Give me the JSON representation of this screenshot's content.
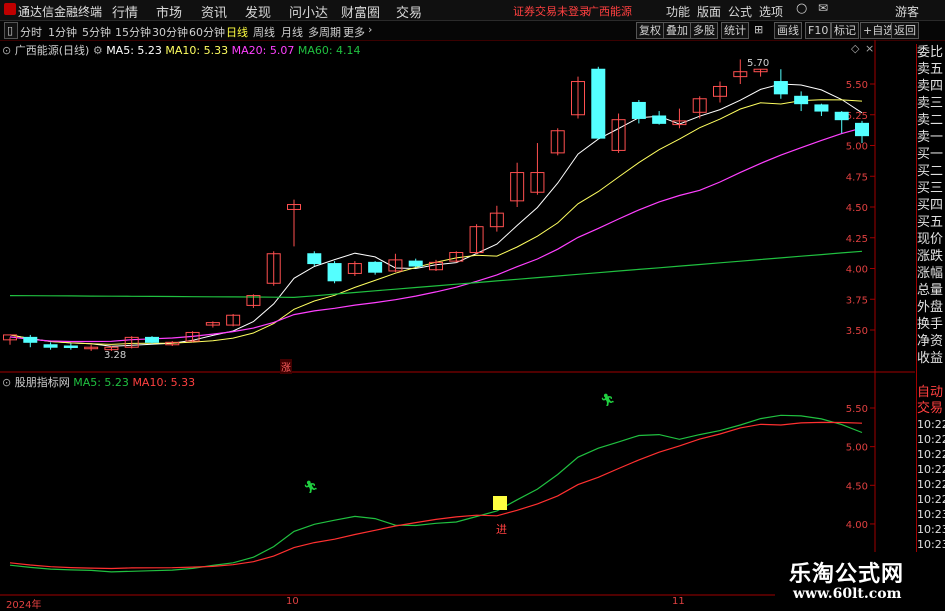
{
  "titlebar": {
    "app_name": "通达信金融终端",
    "menus": [
      "行情",
      "市场",
      "资讯",
      "发现",
      "问小达",
      "财富圈",
      "交易"
    ],
    "status": "证券交易未登录",
    "stock_name": "广西能源",
    "right_menus": [
      "功能",
      "版面",
      "公式",
      "选项"
    ],
    "guest": "游客",
    "colors": {
      "status": "#ff4040"
    }
  },
  "toolbar": {
    "periods": [
      "分时",
      "1分钟",
      "5分钟",
      "15分钟",
      "30分钟",
      "60分钟",
      "日线",
      "周线",
      "月线",
      "多周期",
      "更多"
    ],
    "active_period": "日线",
    "buttons": [
      "复权",
      "叠加",
      "多股",
      "统计",
      "画线",
      "F10",
      "标记",
      "+自选",
      "返回"
    ]
  },
  "main_chart": {
    "title": "广西能源(日线)",
    "ma5_label": "MA5: 5.23",
    "ma10_label": "MA10: 5.33",
    "ma20_label": "MA20: 5.07",
    "ma60_label": "MA60: 4.14",
    "high_label": "5.70",
    "low_label": "3.28",
    "signal_label": "涨",
    "price_ticks": [
      "5.50",
      "5.25",
      "5.00",
      "4.75",
      "4.50",
      "4.25",
      "4.00",
      "3.75",
      "3.50"
    ],
    "colors": {
      "ma5": "#ffffff",
      "ma10": "#ffff60",
      "ma20": "#ff40ff",
      "ma60": "#20c040",
      "up": "#ff5050",
      "down": "#54ffff"
    }
  },
  "indicator": {
    "title": "股朋指标网",
    "ma5_label": "MA5: 5.23",
    "ma10_label": "MA10: 5.33",
    "buy_label": "进",
    "ticks": [
      "5.50",
      "5.00",
      "4.50",
      "4.00"
    ]
  },
  "time_axis": {
    "labels": [
      "2024年",
      "10",
      "11"
    ]
  },
  "right_panel": {
    "items": [
      "委比",
      "卖五",
      "卖四",
      "卖三",
      "卖二",
      "卖一",
      "买一",
      "买二",
      "买三",
      "买四",
      "买五",
      "现价",
      "涨跌",
      "涨幅",
      "总量",
      "外盘",
      "换手",
      "净资",
      "收益"
    ],
    "lower_items": [
      "自动",
      "交易",
      "10:22",
      "10:22",
      "10:22",
      "10:22",
      "10:22",
      "10:22",
      "10:23",
      "10:23",
      "10:23",
      "10:23",
      "10:23"
    ]
  },
  "watermark": {
    "title": "乐淘公式网",
    "url": "www.60lt.com"
  },
  "chart_data": {
    "type": "candlestick",
    "candles": [
      [
        3.42,
        3.46,
        3.38,
        3.44
      ],
      [
        3.44,
        3.4,
        3.36,
        3.46
      ],
      [
        3.38,
        3.36,
        3.34,
        3.4
      ],
      [
        3.37,
        3.36,
        3.34,
        3.39
      ],
      [
        3.35,
        3.36,
        3.33,
        3.38
      ],
      [
        3.34,
        3.36,
        3.33,
        3.37
      ],
      [
        3.36,
        3.44,
        3.35,
        3.45
      ],
      [
        3.44,
        3.4,
        3.39,
        3.45
      ],
      [
        3.38,
        3.4,
        3.37,
        3.41
      ],
      [
        3.41,
        3.48,
        3.4,
        3.49
      ],
      [
        3.54,
        3.56,
        3.52,
        3.57
      ],
      [
        3.54,
        3.62,
        3.53,
        3.63
      ],
      [
        3.7,
        3.78,
        3.68,
        3.79
      ],
      [
        3.88,
        4.12,
        3.86,
        4.14
      ],
      [
        4.48,
        4.52,
        4.18,
        4.56
      ],
      [
        4.12,
        4.04,
        4.02,
        4.14
      ],
      [
        4.04,
        3.9,
        3.88,
        4.06
      ],
      [
        3.96,
        4.04,
        3.94,
        4.06
      ],
      [
        4.05,
        3.97,
        3.95,
        4.06
      ],
      [
        3.98,
        4.07,
        3.97,
        4.12
      ],
      [
        4.06,
        4.02,
        4.01,
        4.08
      ],
      [
        3.99,
        4.05,
        3.98,
        4.07
      ],
      [
        4.06,
        4.13,
        4.05,
        4.14
      ],
      [
        4.13,
        4.34,
        4.12,
        4.36
      ],
      [
        4.34,
        4.45,
        4.3,
        4.51
      ],
      [
        4.55,
        4.78,
        4.5,
        4.86
      ],
      [
        4.62,
        4.78,
        4.6,
        5.02
      ],
      [
        4.94,
        5.12,
        4.92,
        5.14
      ],
      [
        5.25,
        5.52,
        5.22,
        5.56
      ],
      [
        5.62,
        5.06,
        5.05,
        5.64
      ],
      [
        4.96,
        5.21,
        4.94,
        5.26
      ],
      [
        5.35,
        5.22,
        5.18,
        5.37
      ],
      [
        5.24,
        5.18,
        5.17,
        5.28
      ],
      [
        5.17,
        5.2,
        5.14,
        5.3
      ],
      [
        5.27,
        5.38,
        5.22,
        5.4
      ],
      [
        5.4,
        5.48,
        5.35,
        5.52
      ],
      [
        5.56,
        5.6,
        5.5,
        5.7
      ],
      [
        5.6,
        5.62,
        5.56,
        5.62
      ],
      [
        5.52,
        5.42,
        5.38,
        5.62
      ],
      [
        5.4,
        5.34,
        5.28,
        5.44
      ],
      [
        5.33,
        5.28,
        5.24,
        5.34
      ],
      [
        5.27,
        5.21,
        5.1,
        5.28
      ],
      [
        5.18,
        5.08,
        5.02,
        5.2
      ]
    ],
    "ma_values": {
      "ma5": 5.23,
      "ma10": 5.33,
      "ma20": 5.07,
      "ma60": 4.14
    },
    "ylim": [
      3.25,
      5.75
    ],
    "indicator_ylim": [
      3.8,
      5.7
    ]
  }
}
